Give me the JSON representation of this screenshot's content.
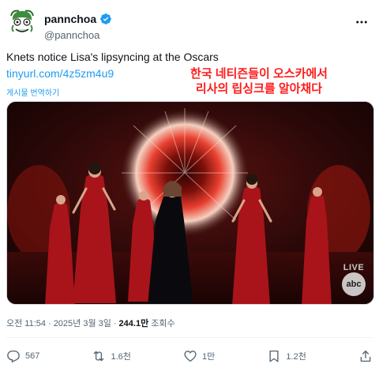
{
  "account": {
    "display_name": "pannchoa",
    "handle": "@pannchoa"
  },
  "tweet": {
    "text": "Knets notice Lisa's lipsyncing at the Oscars",
    "link": "tinyurl.com/4z5zm4u9",
    "translate_label": "게시물 번역하기"
  },
  "media": {
    "caption_line1": "한국 네티즌들이 오스카에서",
    "caption_line2": "리사의 립싱크를 알아채다",
    "live_label": "LIVE",
    "network_label": "abc"
  },
  "meta": {
    "time": "오전 11:54",
    "separator1": "·",
    "date": "2025년 3월 3일",
    "separator2": "·",
    "views_count": "244.1만",
    "views_label": "조회수"
  },
  "actions": {
    "reply_count": "567",
    "retweet_count": "1.6천",
    "like_count": "1만",
    "bookmark_count": "1.2천"
  },
  "colors": {
    "accent": "#1d9bf0",
    "caption_red": "#ff1a1a",
    "muted": "#536471"
  }
}
